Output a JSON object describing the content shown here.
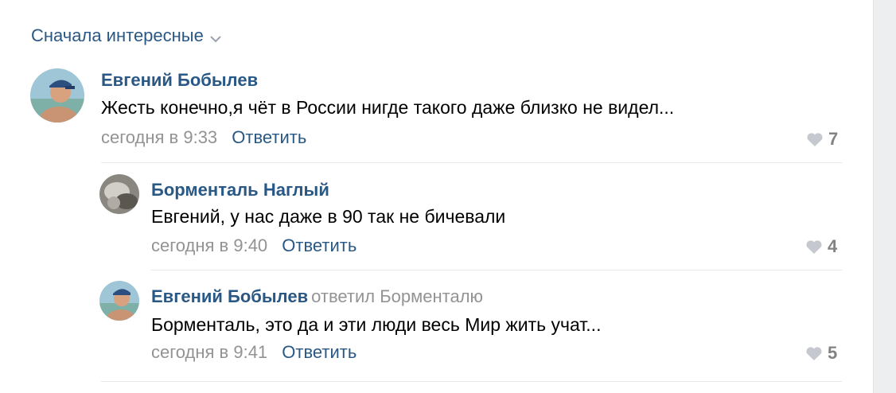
{
  "sort": {
    "label": "Сначала интересные"
  },
  "comments": [
    {
      "author": "Евгений Бобылев",
      "text": "Жесть конечно,я чёт в России нигде такого даже близко не видел...",
      "time": "сегодня в 9:33",
      "reply_label": "Ответить",
      "likes": "7"
    },
    {
      "author": "Борменталь Наглый",
      "text": "Евгений, у нас даже в 90 так не бичевали",
      "time": "сегодня в 9:40",
      "reply_label": "Ответить",
      "likes": "4"
    },
    {
      "author": "Евгений Бобылев",
      "reply_to": "ответил Борменталю",
      "text": "Борменталь, это да и эти люди весь Мир жить учат...",
      "time": "сегодня в 9:41",
      "reply_label": "Ответить",
      "likes": "5"
    }
  ],
  "colors": {
    "link": "#2a5885",
    "meta": "#939393",
    "like_heart": "#c5c9cf"
  }
}
